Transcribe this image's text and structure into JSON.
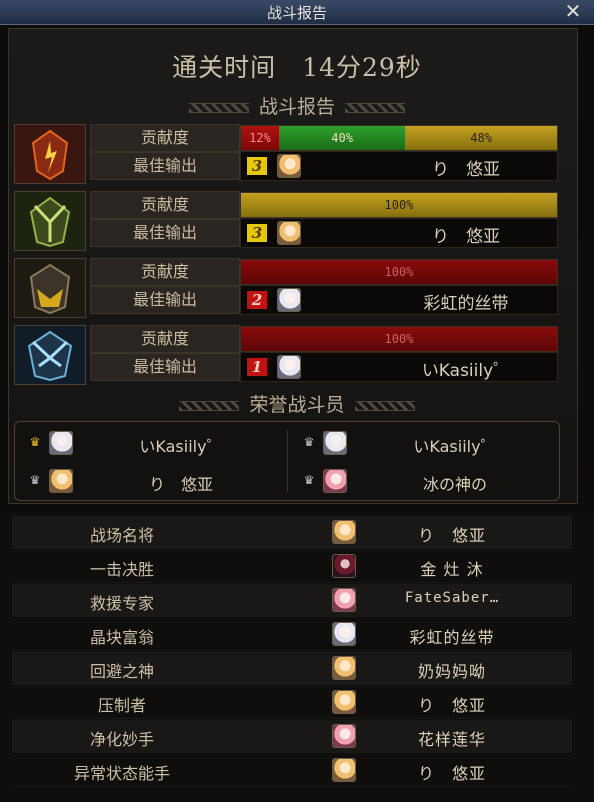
{
  "window": {
    "title": "战斗报告",
    "close_icon": "close-icon"
  },
  "clear_time": {
    "label": "通关时间",
    "value": "14分29秒"
  },
  "battle_report": {
    "heading": "战斗报告",
    "contribution_label": "贡献度",
    "best_output_label": "最佳输出",
    "bosses": [
      {
        "icon": "red-boss-icon",
        "segments": [
          {
            "value": "12%",
            "pct": 12,
            "color": "red"
          },
          {
            "value": "40%",
            "pct": 40,
            "color": "green"
          },
          {
            "value": "48%",
            "pct": 48,
            "color": "gold"
          }
        ],
        "best": {
          "rank": "3",
          "rank_color": "gold",
          "name": "り　悠亚"
        }
      },
      {
        "icon": "green-boss-icon",
        "segments": [
          {
            "value": "100%",
            "pct": 100,
            "color": "gold"
          }
        ],
        "best": {
          "rank": "3",
          "rank_color": "gold",
          "name": "り　悠亚"
        }
      },
      {
        "icon": "gold-boss-icon",
        "segments": [
          {
            "value": "100%",
            "pct": 100,
            "color": "darkred"
          }
        ],
        "best": {
          "rank": "2",
          "rank_color": "red",
          "name": "彩虹的丝带"
        }
      },
      {
        "icon": "blue-boss-icon",
        "segments": [
          {
            "value": "100%",
            "pct": 100,
            "color": "darkred"
          }
        ],
        "best": {
          "rank": "1",
          "rank_color": "red",
          "name": "いKasiily゜"
        }
      }
    ]
  },
  "honor": {
    "heading": "荣誉战斗员",
    "members": [
      {
        "name": "いKasiily゜",
        "crown": "gold-crown-icon"
      },
      {
        "name": "いKasiily゜",
        "crown": "silver-crown-icon"
      },
      {
        "name": "り　悠亚",
        "crown": "silver-crown-icon"
      },
      {
        "name": "冰の神の",
        "crown": "silver-crown-icon"
      }
    ]
  },
  "awards": [
    {
      "title": "战场名将",
      "name": "り　悠亚"
    },
    {
      "title": "一击决胜",
      "name": "金 灶 沐"
    },
    {
      "title": "救援专家",
      "name": "FateSaber…"
    },
    {
      "title": "晶块富翁",
      "name": "彩虹的丝带"
    },
    {
      "title": "回避之神",
      "name": "奶妈妈呦"
    },
    {
      "title": "压制者",
      "name": "り　悠亚"
    },
    {
      "title": "净化妙手",
      "name": "花样莲华"
    },
    {
      "title": "异常状态能手",
      "name": "り　悠亚"
    }
  ],
  "colors": {
    "accent_gold": "#c2a020",
    "accent_red": "#b01010",
    "accent_green": "#2ea02a"
  }
}
